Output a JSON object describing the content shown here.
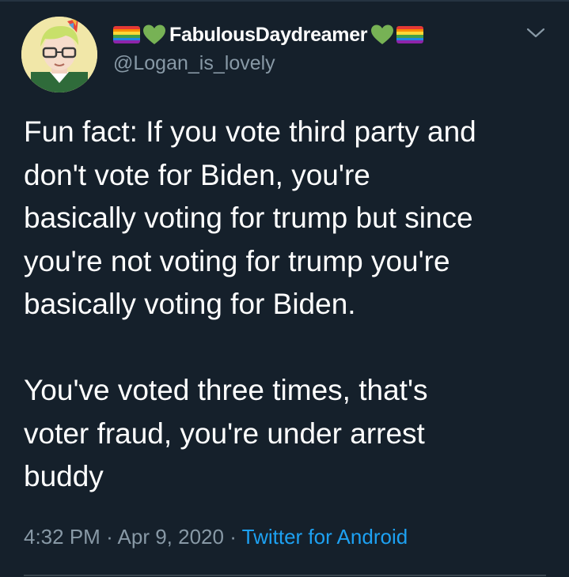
{
  "tweet": {
    "author": {
      "display_name": "FabulousDaydreamer",
      "handle": "@Logan_is_lovely",
      "name_decorations": [
        "rainbow-flag-icon",
        "green-heart-icon",
        "green-heart-icon",
        "rainbow-flag-icon"
      ]
    },
    "text_lines": [
      "Fun fact: If you vote third party and",
      "don't vote for Biden, you're",
      "basically voting for trump but since",
      "you're not voting for trump you're",
      "basically voting for Biden.",
      "You've voted three times, that's",
      "voter fraud, you're under arrest",
      "buddy"
    ],
    "time": "4:32 PM",
    "separator": "·",
    "date": "Apr 9, 2020",
    "source": "Twitter for Android"
  },
  "colors": {
    "background": "#15202b",
    "secondary_text": "#8899a6",
    "link": "#1da1f2",
    "heart": "#77b255"
  }
}
